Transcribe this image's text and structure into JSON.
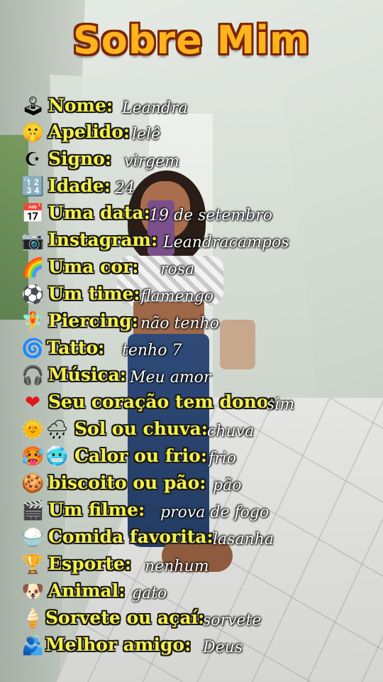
{
  "title": "Sobre Mim",
  "items": [
    {
      "icon": "joystick-icon",
      "glyph": "🕹",
      "label": "Nome:",
      "value": "Leandra"
    },
    {
      "icon": "shushing-face-icon",
      "glyph": "🤫",
      "label": "Apelido:",
      "value": "lelê"
    },
    {
      "icon": "star-and-crescent-icon",
      "glyph": "☪",
      "label": "Signo:",
      "value": "virgem"
    },
    {
      "icon": "numbers-1234-icon",
      "glyph": "🔢",
      "label": "Idade:",
      "value": "24"
    },
    {
      "icon": "calendar-icon",
      "glyph": "📅",
      "label": "Uma data:",
      "value": "19 de setembro"
    },
    {
      "icon": "camera-icon",
      "glyph": "📷",
      "label": "Instagram:",
      "value": "Leandracampos"
    },
    {
      "icon": "rainbow-icon",
      "glyph": "🌈",
      "label": "Uma cor:",
      "value": "rosa"
    },
    {
      "icon": "soccer-ball-icon",
      "glyph": "⚽",
      "label": "Um time:",
      "value": "flamengo"
    },
    {
      "icon": "fairy-icon",
      "glyph": "🧚",
      "label": "Piercing:",
      "value": "não tenho"
    },
    {
      "icon": "cyclone-icon",
      "glyph": "🌀",
      "label": "Tatto:",
      "value": "tenho 7"
    },
    {
      "icon": "headphones-icon",
      "glyph": "🎧",
      "label": "Música:",
      "value": "Meu amor"
    },
    {
      "icon": "red-heart-icon",
      "glyph": "❤",
      "label": "Seu coração tem dono:",
      "value": "sim"
    },
    {
      "icon": "sun-icon",
      "glyph": "🌞",
      "icon2": "rain-cloud-icon",
      "glyph2": "🌧",
      "label": "Sol ou chuva:",
      "value": "chuva"
    },
    {
      "icon": "hot-face-icon",
      "glyph": "🥵",
      "icon2": "cold-face-icon",
      "glyph2": "🥶",
      "label": "Calor ou frio:",
      "value": "frio"
    },
    {
      "icon": "cookie-icon",
      "glyph": "🍪",
      "label": "biscoito ou pão:",
      "value": "pão"
    },
    {
      "icon": "clapper-board-icon",
      "glyph": "🎬",
      "label": "Um filme:",
      "value": "prova de fogo"
    },
    {
      "icon": "rice-bowl-icon",
      "glyph": "🍚",
      "label": "Comida favorita:",
      "value": "lasanha"
    },
    {
      "icon": "trophy-icon",
      "glyph": "🏆",
      "label": "Esporte:",
      "value": "nenhum"
    },
    {
      "icon": "dog-face-icon",
      "glyph": "🐶",
      "label": "Animal:",
      "value": "gato"
    },
    {
      "icon": "ice-cream-icon",
      "glyph": "🍦",
      "label": "Sorvete ou açaí:",
      "value": "sorvete"
    },
    {
      "icon": "hugging-people-icon",
      "glyph": "🫂",
      "label": "Melhor amigo:",
      "value": "Deus"
    }
  ]
}
